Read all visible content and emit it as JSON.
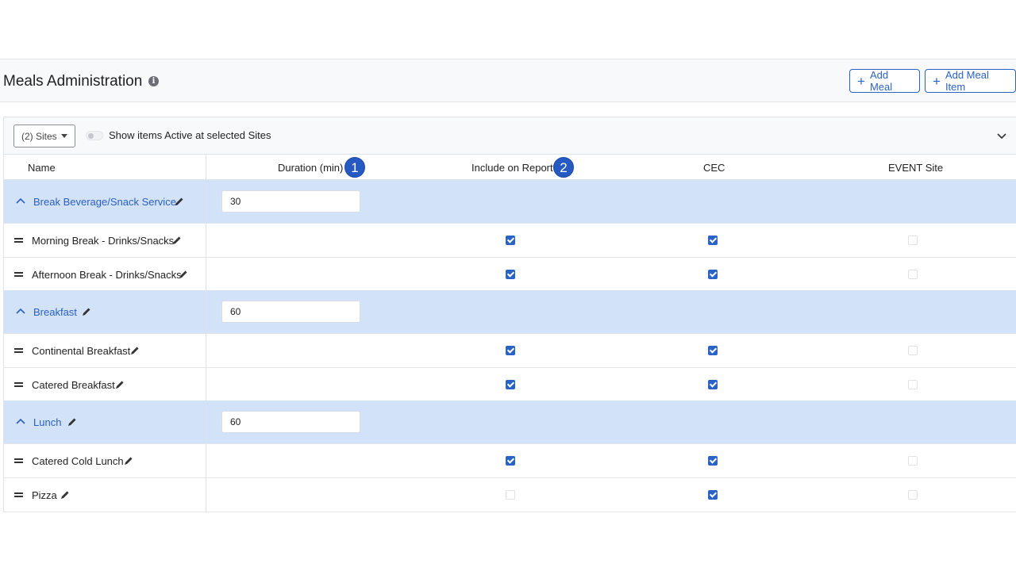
{
  "header": {
    "title": "Meals Administration",
    "info_icon": "info-icon",
    "add_meal_label": "Add Meal",
    "add_meal_item_label": "Add Meal Item"
  },
  "toolbar": {
    "sites_label": "(2) Sites",
    "toggle_label": "Show items Active at selected Sites",
    "toggle_on": false
  },
  "columns": {
    "name": "Name",
    "duration": "Duration (min)",
    "include_on_report": "Include on Report",
    "cec": "CEC",
    "event_site": "EVENT Site"
  },
  "callouts": [
    "1",
    "2"
  ],
  "groups": [
    {
      "name": "Break Beverage/Snack Service",
      "duration": "30",
      "items": [
        {
          "name": "Morning Break - Drinks/Snacks",
          "include_on_report": true,
          "cec": true,
          "event_site": false
        },
        {
          "name": "Afternoon Break - Drinks/Snacks",
          "include_on_report": true,
          "cec": true,
          "event_site": false
        }
      ]
    },
    {
      "name": "Breakfast",
      "duration": "60",
      "items": [
        {
          "name": "Continental Breakfast",
          "include_on_report": true,
          "cec": true,
          "event_site": false
        },
        {
          "name": "Catered Breakfast",
          "include_on_report": true,
          "cec": true,
          "event_site": false
        }
      ]
    },
    {
      "name": "Lunch",
      "duration": "60",
      "items": [
        {
          "name": "Catered Cold Lunch",
          "include_on_report": true,
          "cec": true,
          "event_site": false
        },
        {
          "name": "Pizza",
          "include_on_report": false,
          "cec": true,
          "event_site": false
        }
      ]
    }
  ],
  "colors": {
    "accent": "#2a63c6",
    "group_row_bg": "#d2e2f8",
    "callout_badge": "#2659c2"
  }
}
